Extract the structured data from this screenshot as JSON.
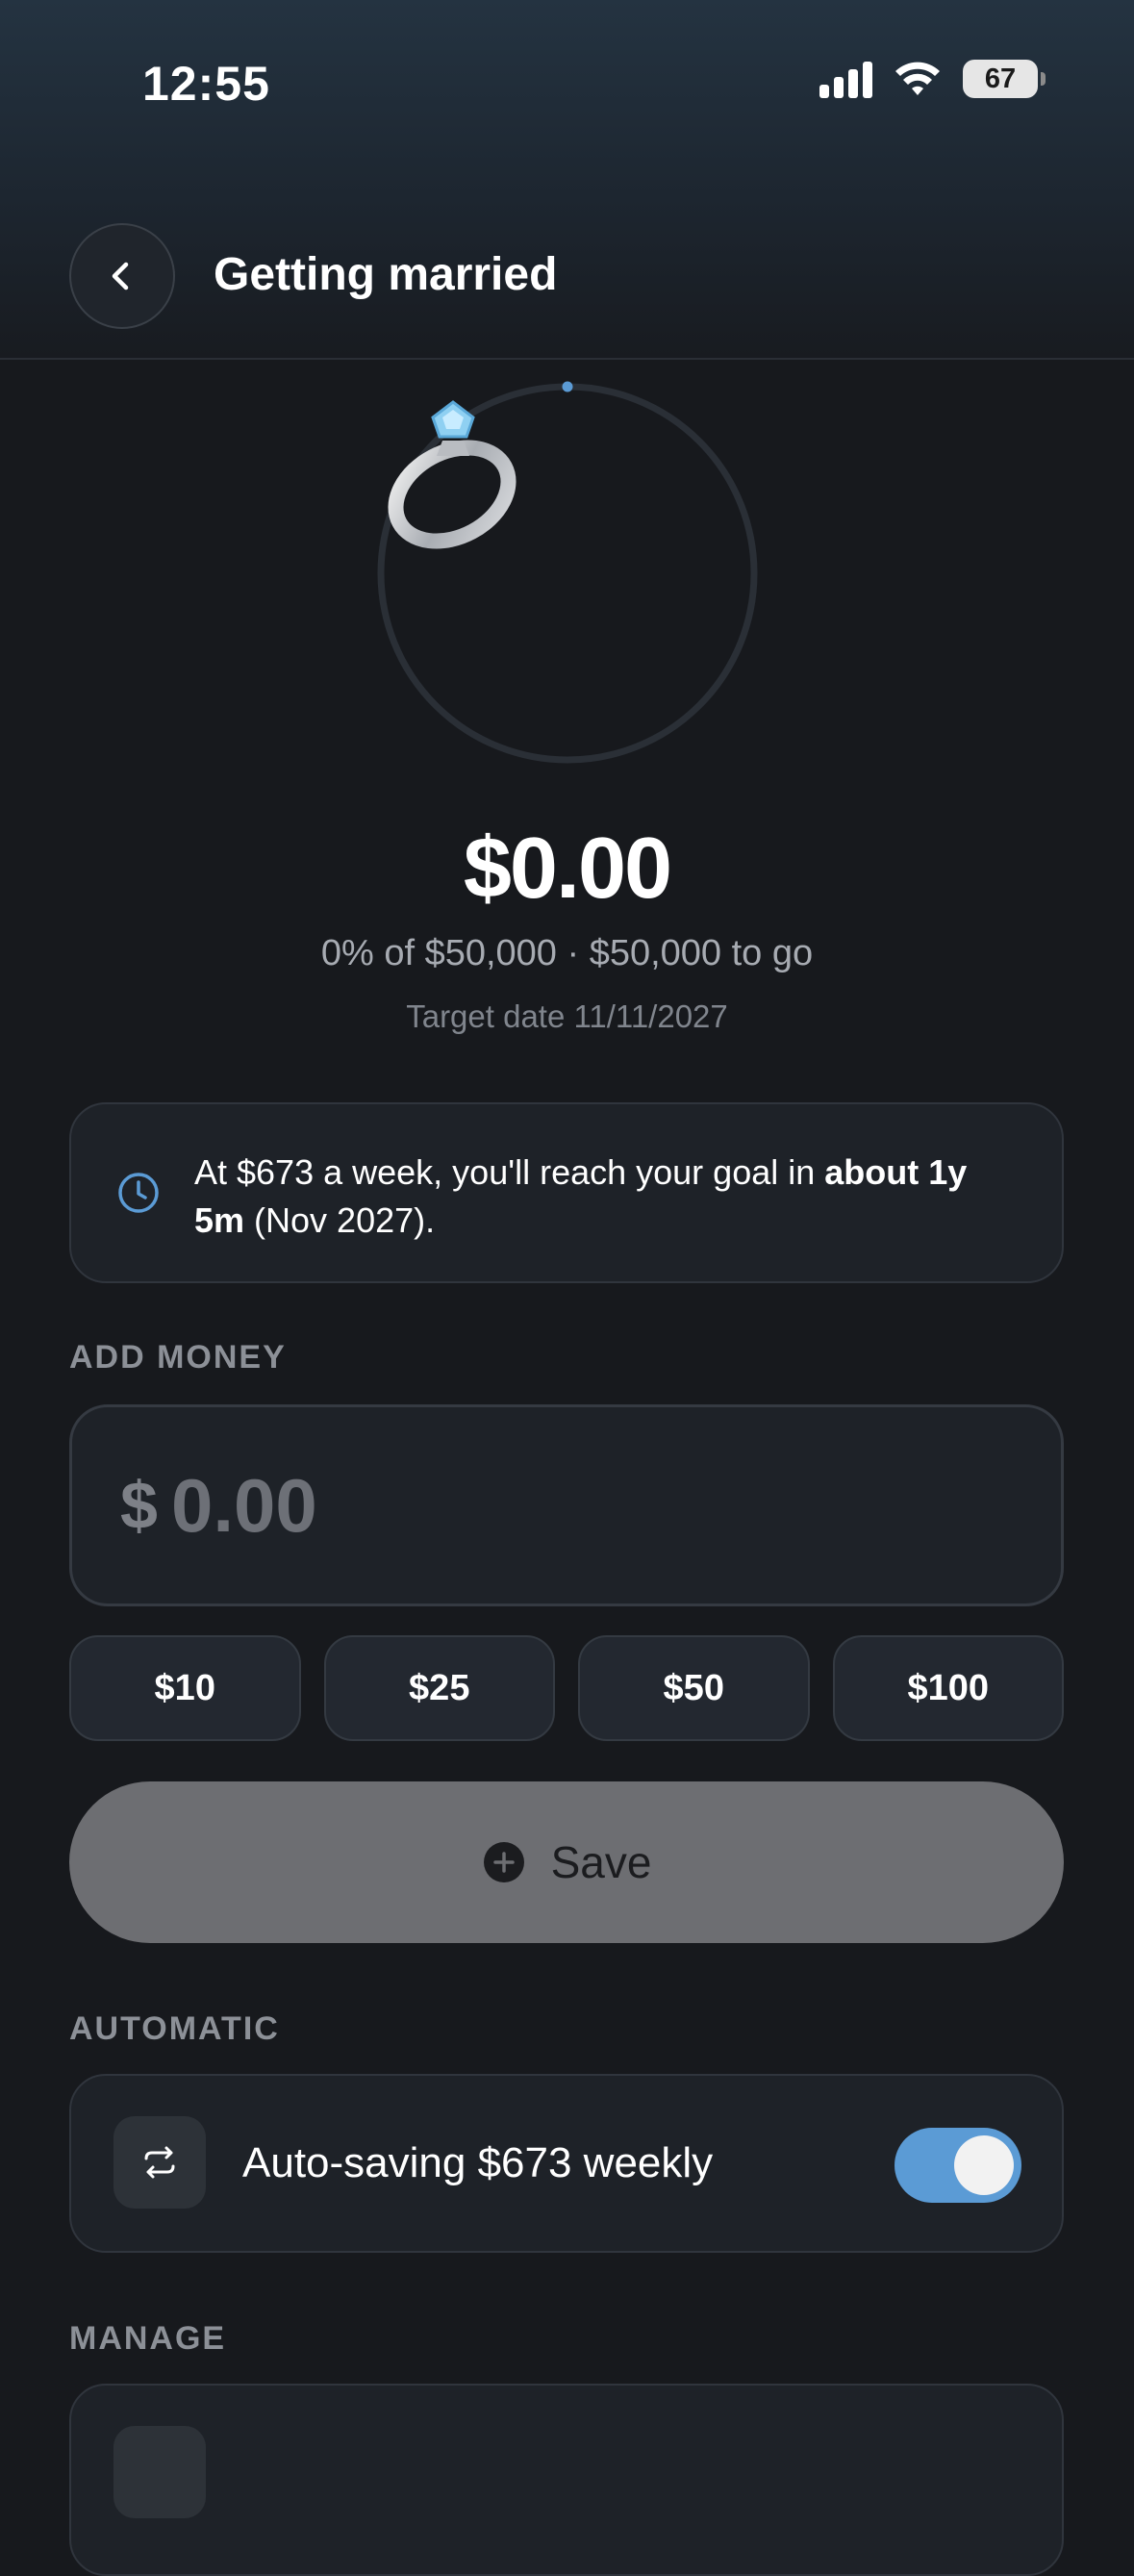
{
  "status_bar": {
    "time": "12:55",
    "battery": "67"
  },
  "header": {
    "title": "Getting married"
  },
  "goal": {
    "emoji": "💍",
    "saved": "$0.00",
    "progress_text": "0% of $50,000 · $50,000 to go",
    "progress_fraction": 0,
    "target_date": "Target date 11/11/2027"
  },
  "info": {
    "prefix": "At $673 a week, you'll reach your goal in ",
    "bold": "about 1y 5m",
    "suffix": " (Nov 2027)."
  },
  "add_money": {
    "label": "ADD MONEY",
    "currency": "$",
    "placeholder": "0.00",
    "quick_amounts": [
      "$10",
      "$25",
      "$50",
      "$100"
    ],
    "save_label": "Save"
  },
  "automatic": {
    "label": "AUTOMATIC",
    "text": "Auto-saving $673 weekly",
    "enabled": true
  },
  "manage": {
    "label": "MANAGE"
  },
  "colors": {
    "accent": "#5b9bd5",
    "background": "#17191d",
    "card": "#1e2228"
  }
}
